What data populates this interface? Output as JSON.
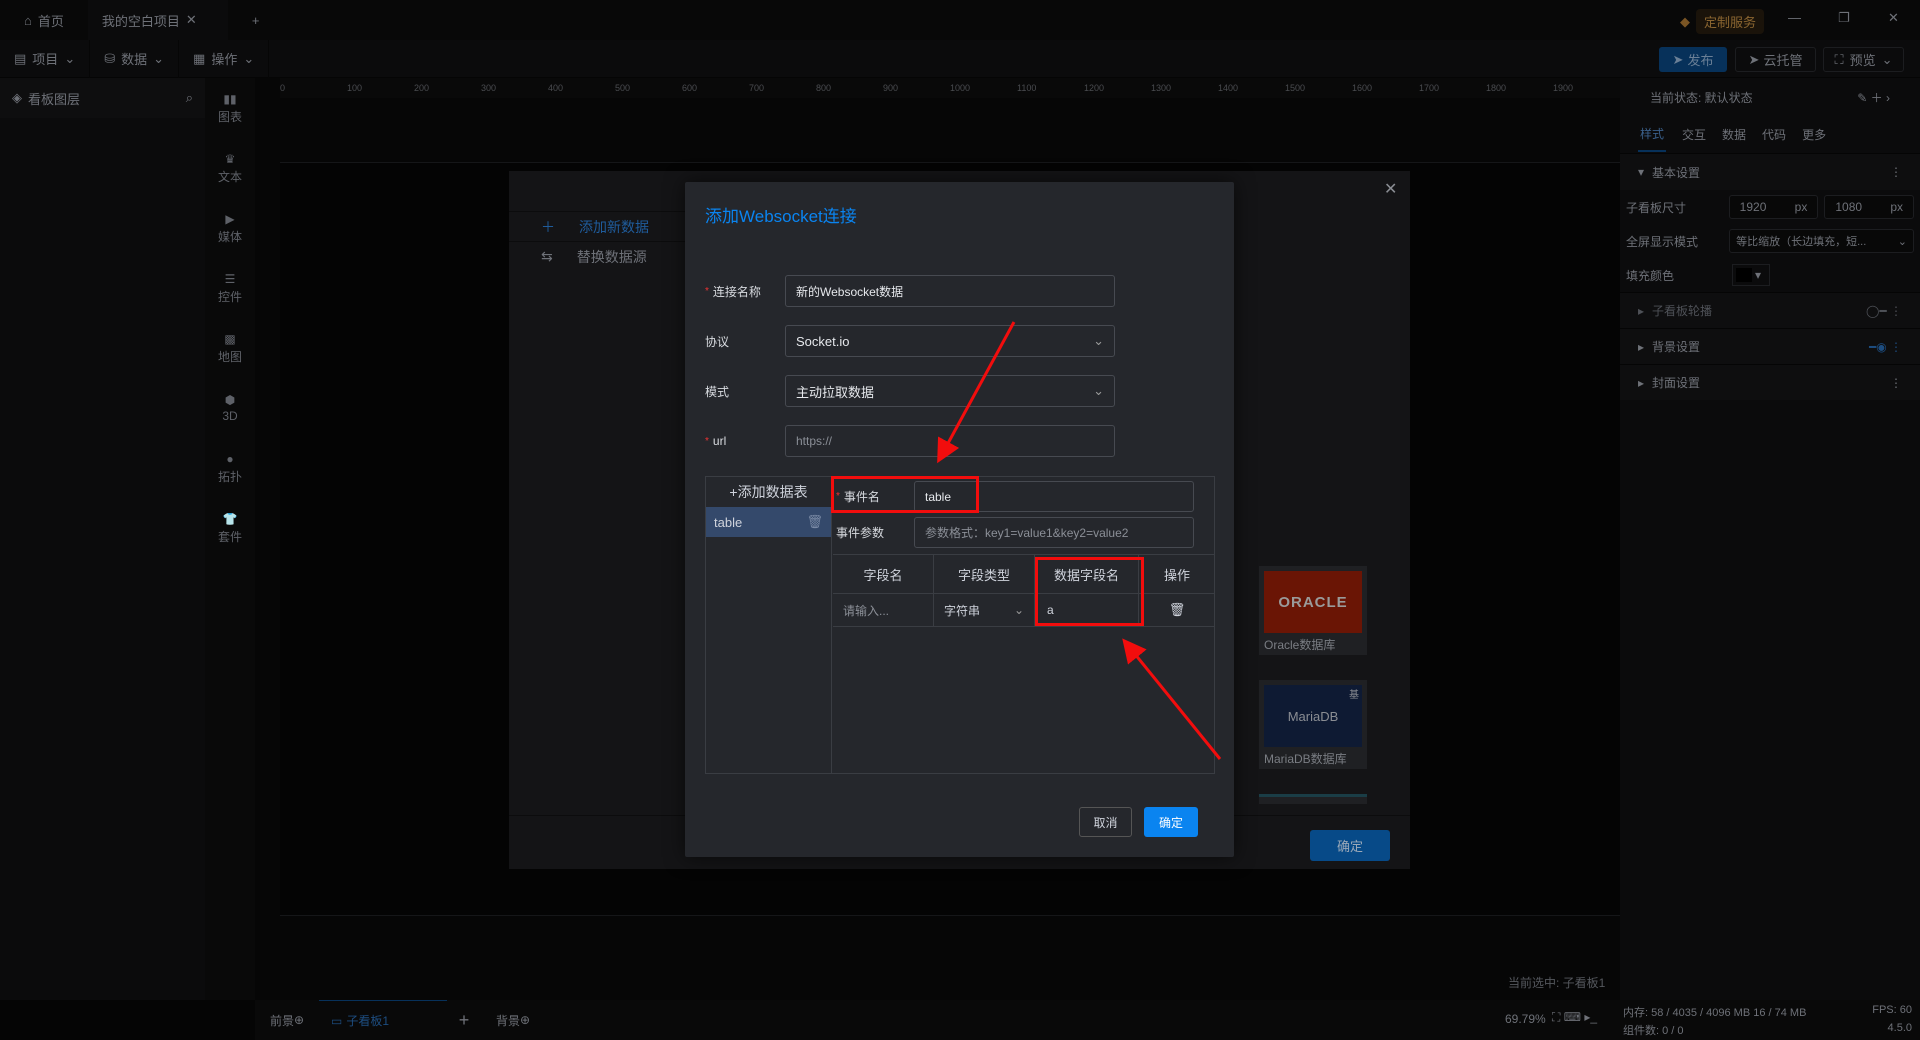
{
  "topbar": {
    "tabs": [
      {
        "label": "首页",
        "icon": "home-icon"
      },
      {
        "label": "我的空白项目",
        "icon": "close-icon"
      }
    ],
    "custom_service": "定制服务"
  },
  "toolbar": {
    "menus": [
      "项目",
      "数据",
      "操作"
    ],
    "publish": "发布",
    "cloud": "云托管",
    "preview": "预览"
  },
  "layers": {
    "title": "看板图层"
  },
  "components": [
    "图表",
    "文本",
    "媒体",
    "控件",
    "地图",
    "3D",
    "拓扑",
    "套件"
  ],
  "ruler": [
    "0",
    "100",
    "200",
    "300",
    "400",
    "500",
    "600",
    "700",
    "800",
    "900",
    "1000",
    "1100",
    "1200",
    "1300",
    "1400",
    "1500",
    "1600",
    "1700",
    "1800",
    "1900"
  ],
  "canvas": {
    "selected": "当前选中: 子看板1"
  },
  "bottom": {
    "front": "前景",
    "board": "子看板1",
    "back": "背景",
    "zoom": "69.79%",
    "memory": "内存: 58 / 4035 / 4096 MB  16 / 74 MB",
    "fps": "FPS: 60",
    "count": "组件数: 0 / 0",
    "version": "4.5.0"
  },
  "rightpanel": {
    "state": "当前状态: 默认状态",
    "tabs": [
      "样式",
      "交互",
      "数据",
      "代码",
      "更多"
    ],
    "basic": "基本设置",
    "size_label": "子看板尺寸",
    "width": "1920",
    "height": "1080",
    "unit": "px",
    "fullscreen_label": "全屏显示模式",
    "fullscreen_value": "等比缩放（长边填充，短...",
    "fill_label": "填充颜色",
    "carousel": "子看板轮播",
    "bg": "背景设置",
    "cover": "封面设置"
  },
  "bgmodal": {
    "add": "添加新数据",
    "replace": "替换数据源",
    "cards": [
      "Oracle数据库",
      "MariaDB数据库"
    ],
    "oracle_logo": "ORACLE",
    "mariadb_logo": "MariaDB Foundation",
    "badge": "基",
    "ok": "确定"
  },
  "dialog": {
    "title": "添加Websocket连接",
    "name_label": "连接名称",
    "name_value": "新的Websocket数据",
    "protocol_label": "协议",
    "protocol_value": "Socket.io",
    "mode_label": "模式",
    "mode_value": "主动拉取数据",
    "url_label": "url",
    "url_placeholder": "https://",
    "add_table": "+添加数据表",
    "tables": [
      "table"
    ],
    "event_label": "事件名",
    "event_value": "table",
    "params_label": "事件参数",
    "params_placeholder": "参数格式：key1=value1&key2=value2",
    "columns": [
      "字段名",
      "字段类型",
      "数据字段名",
      "操作"
    ],
    "row": {
      "field_placeholder": "请输入...",
      "type": "字符串",
      "data_field": "a"
    },
    "cancel": "取消",
    "ok": "确定"
  },
  "colors": {
    "accent": "#0a84f0",
    "annotation": "#f20d0d"
  }
}
